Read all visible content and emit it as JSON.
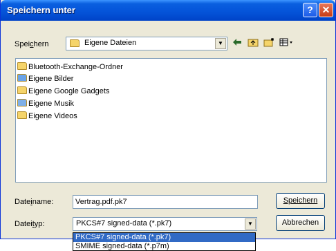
{
  "window": {
    "title": "Speichern unter",
    "help_button": "?",
    "close_button": "✕"
  },
  "save_in": {
    "label": "Speichern",
    "selected": "Eigene Dateien"
  },
  "toolbar": {
    "back_icon": "back-arrow-icon",
    "up_icon": "up-folder-icon",
    "new_folder_icon": "new-folder-icon",
    "views_icon": "views-menu-icon"
  },
  "files": [
    {
      "name": "Bluetooth-Exchange-Ordner",
      "icon": "folder-icon",
      "color": "#f5d46a"
    },
    {
      "name": "Eigene Bilder",
      "icon": "pictures-folder-icon",
      "color": "#6aa3e8"
    },
    {
      "name": "Eigene Google Gadgets",
      "icon": "folder-icon",
      "color": "#f5d46a"
    },
    {
      "name": "Eigene Musik",
      "icon": "music-folder-icon",
      "color": "#7fb0e8"
    },
    {
      "name": "Eigene Videos",
      "icon": "video-folder-icon",
      "color": "#f5d46a"
    }
  ],
  "filename": {
    "label": "Dateiname:",
    "value": "Vertrag.pdf.pk7"
  },
  "filetype": {
    "label": "Dateityp:",
    "selected": "PKCS#7 signed-data (*.pk7)",
    "options": [
      "PKCS#7 signed-data (*.pk7)",
      "SMIME signed-data (*.p7m)"
    ]
  },
  "buttons": {
    "save": "Speichern",
    "cancel": "Abbrechen"
  },
  "colors": {
    "titlebar": "#0453d8",
    "dialog_bg": "#ece9d8",
    "selection": "#316ac5"
  }
}
